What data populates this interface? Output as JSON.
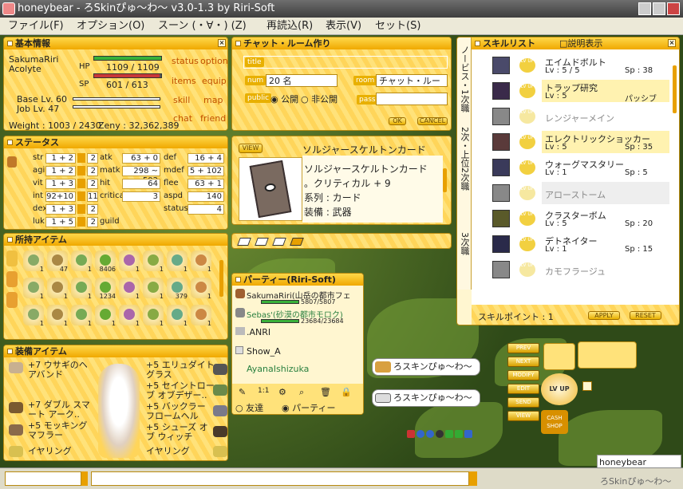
{
  "window": {
    "title": "honeybear - ろSkinぴゅ～わ～ v3.0-1.3 by Riri-Soft"
  },
  "menu": [
    "ファイル(F)",
    "オプション(O)",
    "スーン (・∀・) (Z)",
    "再読込(R)",
    "表示(V)",
    "セット(S)"
  ],
  "basic": {
    "title": "基本情報",
    "name": "SakumaRiri",
    "job": "Acolyte",
    "hp_label": "HP",
    "hp": "1109 / 1109",
    "hp_frac": 1.0,
    "sp_label": "SP",
    "sp": "601 / 613",
    "sp_frac": 0.98,
    "base_lv": "Base Lv. 60",
    "job_lv": "Job Lv. 47",
    "weight": "Weight : 1003 / 2430",
    "zeny": "Zeny : 32,362,389",
    "buttons": [
      "status",
      "option",
      "items",
      "equip",
      "skill",
      "map",
      "chat",
      "friend"
    ]
  },
  "chatroom": {
    "title": "チャット・ルーム作り",
    "title_label": "title",
    "num_label": "num",
    "num_value": "20 名",
    "room_label": "room",
    "room_value": "チャット・ルー",
    "public_label": "public",
    "public_opt": "公開",
    "private_opt": "非公開",
    "pass_label": "pass",
    "ok": "OK",
    "cancel": "CANCEL"
  },
  "item_detail": {
    "view": "VIEW",
    "name": "ソルジャースケルトンカード",
    "line1": "ソルジャースケルトンカード",
    "line2": "。クリティカル + 9",
    "line3": "系列 : カード",
    "line4": "装備 : 武器"
  },
  "status": {
    "title": "ステータス",
    "rows": [
      {
        "k": "str",
        "v": "1 + 2",
        "n": "2",
        "a": "atk",
        "av": "63 + 0",
        "b": "def",
        "bv": "16 + 4"
      },
      {
        "k": "agi",
        "v": "1 + 2",
        "n": "2",
        "a": "matk",
        "av": "298 ~ 502",
        "b": "mdef",
        "bv": "5 + 102"
      },
      {
        "k": "vit",
        "v": "1 + 3",
        "n": "2",
        "a": "hit",
        "av": "64",
        "b": "flee",
        "bv": "63 + 1"
      },
      {
        "k": "int",
        "v": "92+10",
        "n": "11",
        "a": "critical",
        "av": "3",
        "b": "aspd",
        "bv": "140"
      },
      {
        "k": "dex",
        "v": "1 + 3",
        "n": "2",
        "a": "",
        "av": "",
        "b": "status point",
        "bv": "4"
      },
      {
        "k": "luk",
        "v": "1 + 5",
        "n": "2",
        "a": "guild",
        "av": "",
        "b": "",
        "bv": ""
      }
    ]
  },
  "inventory": {
    "title": "所持アイテム",
    "counts": [
      "1",
      "47",
      "1",
      "8406",
      "1",
      "1",
      "1",
      "1",
      "1",
      "1",
      "1",
      "1234",
      "1",
      "1",
      "379",
      "1",
      "1",
      "1",
      "1",
      "1",
      "1",
      "1",
      "1",
      "1"
    ]
  },
  "party": {
    "title": "パーティー(Riri-Soft)",
    "members": [
      {
        "name": "SakumaRiri(山岳の都市フェ",
        "hp": "5807/5807",
        "hp_frac": 1.0
      },
      {
        "name": "Sebas'(砂漠の都市モロク)",
        "hp": "23684/23684",
        "hp_frac": 1.0
      },
      {
        "name": ".ANRI",
        "hp": "",
        "hp_frac": 0
      },
      {
        "name": "Show_A",
        "hp": "",
        "hp_frac": 0
      },
      {
        "name": "AyanaIshizuka",
        "hp": "",
        "hp_frac": 0
      }
    ],
    "tab_friend": "友達",
    "tab_party": "パーティー"
  },
  "equipment": {
    "title": "装備アイテム",
    "left": [
      "+7 ウサギのヘアバンド",
      "+7 ダブル スマート アーク..",
      "+5 モッキング マフラー",
      "イヤリング"
    ],
    "right": [
      "+5 エリュダイト グラス",
      "+5 セイントローブ オブデザー..",
      "+5 バックラー フロームヘル",
      "+5 シューズ オブ ウィッチ",
      "イヤリング"
    ]
  },
  "skills": {
    "title": "スキルリスト",
    "desc_label": "□説明表示",
    "tabs": [
      "ノービス・1次職",
      "2次・上位2次職",
      "3次職"
    ],
    "list": [
      {
        "name": "エイムドボルト",
        "lv": "Lv : 5 / 5",
        "sp": "Sp : 38",
        "hl": false,
        "gray": false
      },
      {
        "name": "トラップ研究",
        "lv": "Lv : 5",
        "sp": "パッシブ",
        "hl": true,
        "gray": false
      },
      {
        "name": "レンジャーメイン",
        "lv": "",
        "sp": "",
        "hl": false,
        "gray": true
      },
      {
        "name": "エレクトリックショッカー",
        "lv": "Lv : 5",
        "sp": "Sp : 35",
        "hl": true,
        "gray": false
      },
      {
        "name": "ウォーグマスタリー",
        "lv": "Lv : 1",
        "sp": "Sp : 5",
        "hl": false,
        "gray": false
      },
      {
        "name": "アローストーム",
        "lv": "",
        "sp": "",
        "hl": true,
        "gray": true
      },
      {
        "name": "クラスターボム",
        "lv": "Lv : 5",
        "sp": "Sp : 20",
        "hl": false,
        "gray": false
      },
      {
        "name": "デトネイター",
        "lv": "Lv : 1",
        "sp": "Sp : 15",
        "hl": false,
        "gray": false
      },
      {
        "name": "カモフラージュ",
        "lv": "",
        "sp": "",
        "hl": false,
        "gray": true
      }
    ],
    "points": "スキルポイント : 1",
    "apply": "APPLY",
    "reset": "RESET"
  },
  "bubbles": [
    "ろスキンぴゅ～わ～",
    "ろスキンぴゅ～わ～"
  ],
  "side_buttons": [
    "PREV",
    "NEXT",
    "MODIFY",
    "EDIT",
    "SEND",
    "VIEW"
  ],
  "lvup": "LV UP",
  "cashshop": "CASH SHOP",
  "bottom": {
    "name": "honeybear",
    "watermark": "ろSkinぴゅ～わ～"
  }
}
